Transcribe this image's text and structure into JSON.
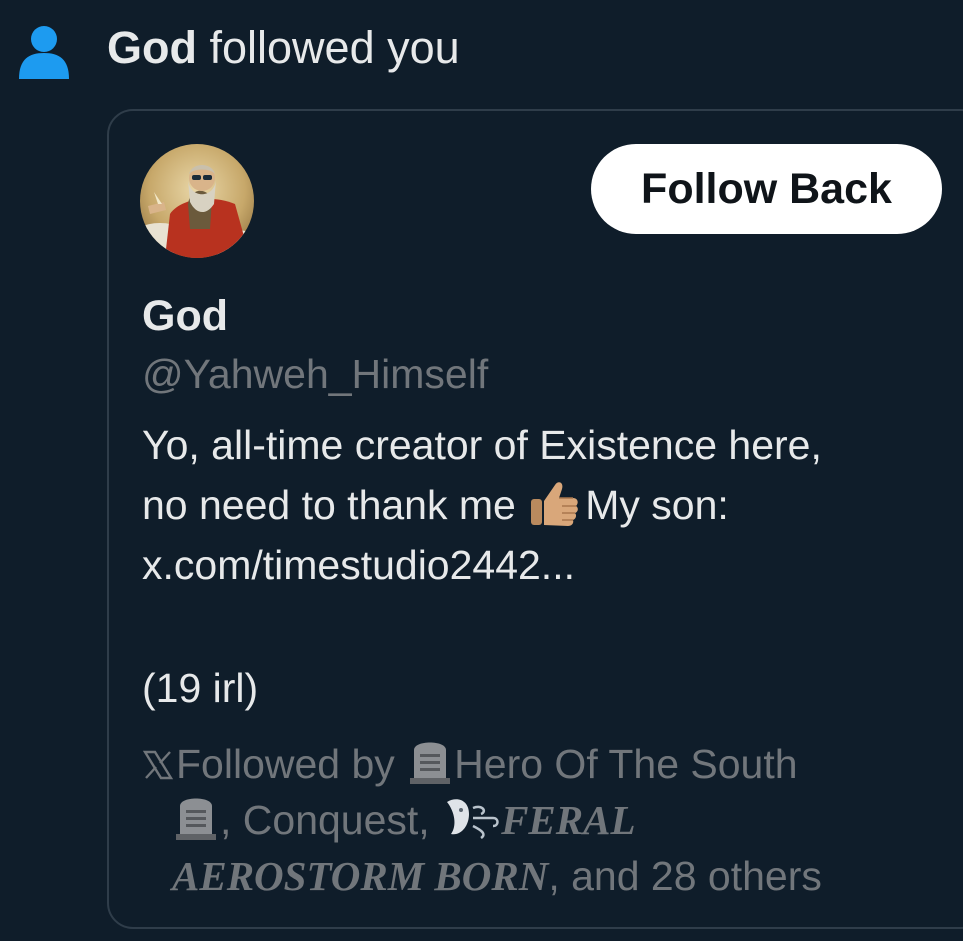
{
  "notification": {
    "actor": "God",
    "action_text": " followed you"
  },
  "profile": {
    "display_name": "God",
    "handle": "@Yahweh_Himself",
    "follow_button_label": "Follow Back",
    "bio": {
      "line1": "Yo, all-time creator of Existence here,",
      "line2_before": "no need to thank me",
      "line2_after": "My son:",
      "link": "x.com/timestudio2442...",
      "line_age": "(19 irl)"
    },
    "followed_by": {
      "prefix": "Followed by ",
      "user1": "Hero Of The South",
      "sep1": ", Conquest, ",
      "user3_part1": "FERAL",
      "user3_part2": "AEROSTORM BORN",
      "suffix": ", and 28 others"
    }
  },
  "colors": {
    "background": "#0f1d2a",
    "primary_text": "#e7e9ea",
    "secondary_text": "#71767b",
    "accent_blue": "#1d9bf0",
    "button_bg": "#ffffff"
  },
  "icons": [
    "person-icon",
    "avatar-image",
    "thumbs-up-icon",
    "x-logo-icon",
    "headstone-icon",
    "wind-face-icon"
  ]
}
